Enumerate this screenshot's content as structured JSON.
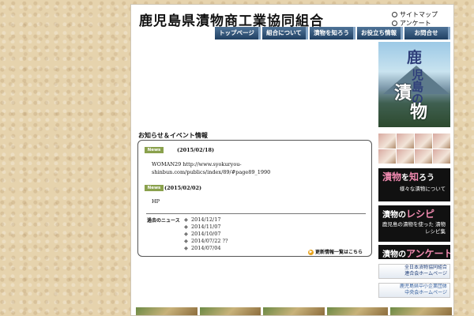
{
  "header": {
    "site_title": "鹿児島県漬物商工業協同組合",
    "utility_links": [
      "サイトマップ",
      "アンケート"
    ]
  },
  "nav": {
    "tabs": [
      "トップページ",
      "組合について",
      "漬物を知ろう",
      "お役立ち情報",
      "お問合せ"
    ]
  },
  "news": {
    "heading": "お知らせ＆イベント情報",
    "items": [
      {
        "badge": "News",
        "date": "(2015/02/18)",
        "body": "WOMAN29  http://www.syokuryou-shinbun.com/publics/index/89/#page89_1990"
      },
      {
        "badge": "News",
        "date": "(2015/02/02)",
        "body": "HP"
      }
    ],
    "past_label": "過去のニュース",
    "past_items": [
      "2014/12/17",
      "2014/11/07",
      "2014/10/07",
      "2014/07/22  ??",
      "2014/07/04"
    ],
    "more_link": "更新情報一覧はこちら"
  },
  "sidebar": {
    "hero_text": [
      "鹿",
      "児島の",
      "漬",
      "物"
    ],
    "banners": [
      {
        "big_pre": "",
        "big_em": "漬物",
        "big_mid": "を",
        "big_em2": "知",
        "big_post": "ろう",
        "small": "様々な漬物について"
      },
      {
        "big_pre": "漬物の",
        "big_em": "レシピ",
        "big_mid": "",
        "big_em2": "",
        "big_post": "",
        "small": "鹿児島の漬物を使った 漬物レシピ集"
      },
      {
        "big_pre": "漬物の",
        "big_em": "アンケート",
        "big_mid": "",
        "big_em2": "",
        "big_post": "",
        "small": ""
      }
    ],
    "link_banners": [
      {
        "line1": "全日本漬物協同組合",
        "line2": "連合会ホームページ"
      },
      {
        "line1": "鹿児島県中小企業団体",
        "line2": "中央会ホームページ"
      }
    ]
  }
}
